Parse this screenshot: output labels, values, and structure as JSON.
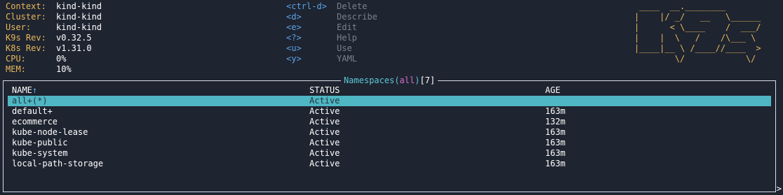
{
  "header": {
    "info": [
      {
        "key": "Context:",
        "value": "kind-kind"
      },
      {
        "key": "Cluster:",
        "value": "kind-kind"
      },
      {
        "key": "User:",
        "value": "kind-kind"
      },
      {
        "key": "K9s Rev:",
        "value": "v0.32.5"
      },
      {
        "key": "K8s Rev:",
        "value": "v1.31.0"
      },
      {
        "key": "CPU:",
        "value": "0%"
      },
      {
        "key": "MEM:",
        "value": "10%"
      }
    ],
    "keys": [
      {
        "hint": "<ctrl-d>",
        "action": "Delete"
      },
      {
        "hint": "<d>",
        "action": "Describe"
      },
      {
        "hint": "<e>",
        "action": "Edit"
      },
      {
        "hint": "<?>",
        "action": "Help"
      },
      {
        "hint": "<u>",
        "action": "Use"
      },
      {
        "hint": "<y>",
        "action": "YAML"
      }
    ],
    "logo": " ____  __.________       \n|    |/ _/   __   \\______\n|      < \\____    /  ___/\n|    |  \\   /    /\\___ \\ \n|____|__ \\ /____//____  >\n        \\/            \\/ "
  },
  "view": {
    "title_name": "Namespaces",
    "title_filter": "all",
    "title_count": "7",
    "columns": {
      "name": "NAME",
      "sort_marker": "↑",
      "status": "STATUS",
      "age": "AGE"
    },
    "rows": [
      {
        "name": "all+(*)",
        "status": "Active",
        "age": ""
      },
      {
        "name": "default+",
        "status": "Active",
        "age": "163m"
      },
      {
        "name": "ecommerce",
        "status": "Active",
        "age": "132m"
      },
      {
        "name": "kube-node-lease",
        "status": "Active",
        "age": "163m"
      },
      {
        "name": "kube-public",
        "status": "Active",
        "age": "163m"
      },
      {
        "name": "kube-system",
        "status": "Active",
        "age": "163m"
      },
      {
        "name": "local-path-storage",
        "status": "Active",
        "age": "163m"
      }
    ],
    "selected_row": 0,
    "scroll_indicator": ">"
  },
  "colors": {
    "background": "#1e2430",
    "info_key": "#e8b85b",
    "key_hint": "#5aa2e6",
    "key_action": "#7b818c",
    "selected_row": "#4fb6c4",
    "title": "#5ec8d8",
    "filter": "#d46fd0"
  }
}
